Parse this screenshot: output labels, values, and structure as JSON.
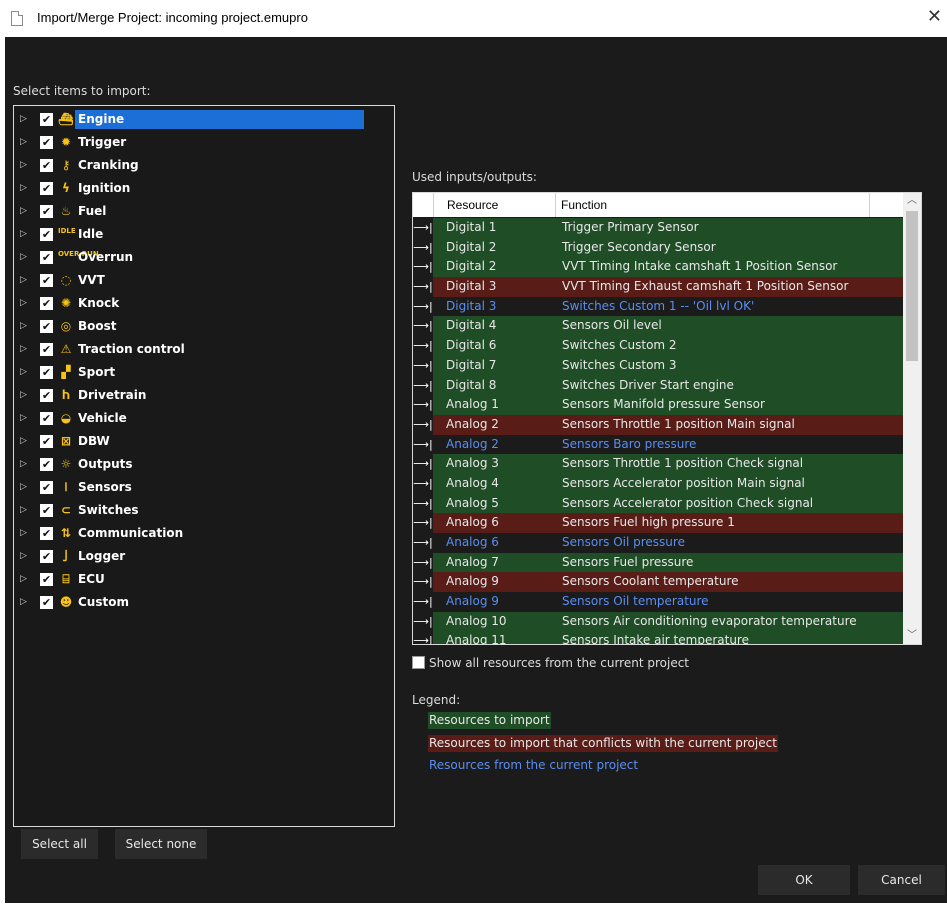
{
  "window": {
    "title": "Import/Merge Project: incoming project.emupro",
    "close_glyph": "✕"
  },
  "left_panel": {
    "label": "Select items to import:",
    "items": [
      {
        "label": "Engine",
        "icon": "engine-icon",
        "glyph": "⛴",
        "selected": true
      },
      {
        "label": "Trigger",
        "icon": "gear-icon",
        "glyph": "✹"
      },
      {
        "label": "Cranking",
        "icon": "key-icon",
        "glyph": "⚷"
      },
      {
        "label": "Ignition",
        "icon": "lightning-icon",
        "glyph": "ϟ"
      },
      {
        "label": "Fuel",
        "icon": "fuel-icon",
        "glyph": "♨"
      },
      {
        "label": "Idle",
        "icon": "idle-icon",
        "glyph": "IDLE",
        "small": true
      },
      {
        "label": "Overrun",
        "icon": "overrun-icon",
        "glyph": "OVER RUN",
        "small": true
      },
      {
        "label": "VVT",
        "icon": "vvt-icon",
        "glyph": "◌"
      },
      {
        "label": "Knock",
        "icon": "knock-icon",
        "glyph": "✺"
      },
      {
        "label": "Boost",
        "icon": "turbo-icon",
        "glyph": "◎"
      },
      {
        "label": "Traction control",
        "icon": "traction-icon",
        "glyph": "⚠"
      },
      {
        "label": "Sport",
        "icon": "checkered-flag-icon",
        "glyph": "▞"
      },
      {
        "label": "Drivetrain",
        "icon": "drivetrain-icon",
        "glyph": "Ⴙ"
      },
      {
        "label": "Vehicle",
        "icon": "car-icon",
        "glyph": "◒"
      },
      {
        "label": "DBW",
        "icon": "throttle-icon",
        "glyph": "⊠"
      },
      {
        "label": "Outputs",
        "icon": "bulb-icon",
        "glyph": "☼"
      },
      {
        "label": "Sensors",
        "icon": "thermometer-icon",
        "glyph": "𝍩"
      },
      {
        "label": "Switches",
        "icon": "switch-icon",
        "glyph": "⊂"
      },
      {
        "label": "Communication",
        "icon": "arrows-icon",
        "glyph": "⇅"
      },
      {
        "label": "Logger",
        "icon": "logger-icon",
        "glyph": "⼅"
      },
      {
        "label": "ECU",
        "icon": "ecu-chip-icon",
        "glyph": "⌸"
      },
      {
        "label": "Custom",
        "icon": "person-icon",
        "glyph": "☻"
      }
    ],
    "select_all": "Select all",
    "select_none": "Select none"
  },
  "io_panel": {
    "label": "Used inputs/outputs:",
    "columns": [
      "Resource",
      "Function"
    ],
    "rows": [
      {
        "resource": "Digital 1",
        "function": "Trigger Primary Sensor",
        "kind": "import"
      },
      {
        "resource": "Digital 2",
        "function": "Trigger Secondary Sensor",
        "kind": "import"
      },
      {
        "resource": "Digital 2",
        "function": "VVT Timing Intake camshaft 1 Position Sensor",
        "kind": "import"
      },
      {
        "resource": "Digital 3",
        "function": "VVT Timing Exhaust camshaft 1 Position Sensor",
        "kind": "conflict"
      },
      {
        "resource": "Digital 3",
        "function": "Switches Custom 1 -- 'Oil lvl OK'",
        "kind": "current"
      },
      {
        "resource": "Digital 4",
        "function": "Sensors Oil level",
        "kind": "import"
      },
      {
        "resource": "Digital 6",
        "function": "Switches Custom 2",
        "kind": "import"
      },
      {
        "resource": "Digital 7",
        "function": "Switches Custom 3",
        "kind": "import"
      },
      {
        "resource": "Digital 8",
        "function": "Switches Driver Start engine",
        "kind": "import"
      },
      {
        "resource": "Analog 1",
        "function": "Sensors Manifold pressure Sensor",
        "kind": "import"
      },
      {
        "resource": "Analog 2",
        "function": "Sensors Throttle 1 position Main signal",
        "kind": "conflict"
      },
      {
        "resource": "Analog 2",
        "function": "Sensors Baro pressure",
        "kind": "current"
      },
      {
        "resource": "Analog 3",
        "function": "Sensors Throttle 1 position Check signal",
        "kind": "import"
      },
      {
        "resource": "Analog 4",
        "function": "Sensors Accelerator position Main signal",
        "kind": "import"
      },
      {
        "resource": "Analog 5",
        "function": "Sensors Accelerator position Check signal",
        "kind": "import"
      },
      {
        "resource": "Analog 6",
        "function": "Sensors Fuel high pressure 1",
        "kind": "conflict"
      },
      {
        "resource": "Analog 6",
        "function": "Sensors Oil pressure",
        "kind": "current"
      },
      {
        "resource": "Analog 7",
        "function": "Sensors Fuel pressure",
        "kind": "import"
      },
      {
        "resource": "Analog 9",
        "function": "Sensors Coolant temperature",
        "kind": "conflict"
      },
      {
        "resource": "Analog 9",
        "function": "Sensors Oil temperature",
        "kind": "current"
      },
      {
        "resource": "Analog 10",
        "function": "Sensors Air conditioning evaporator temperature",
        "kind": "import"
      },
      {
        "resource": "Analog 11",
        "function": "Sensors Intake air temperature",
        "kind": "import"
      }
    ],
    "show_all": "Show all resources from the current project"
  },
  "legend": {
    "title": "Legend:",
    "items": [
      {
        "label": "Resources to import"
      },
      {
        "label": "Resources to import that conflicts with the current project"
      },
      {
        "label": "Resources from the current project"
      }
    ]
  },
  "colors": {
    "import_bg": "#1f4d26",
    "conflict_bg": "#5a1c17",
    "current_fg": "#5b8ef0",
    "selected_bg": "#1d6fd8",
    "icon_yellow": "#f7c415"
  },
  "buttons": {
    "ok": "OK",
    "cancel": "Cancel"
  }
}
